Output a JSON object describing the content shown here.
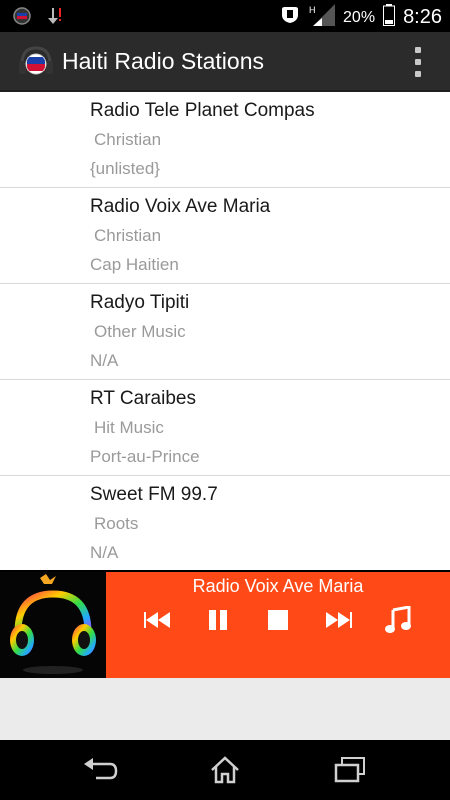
{
  "status_bar": {
    "left_icons": [
      "app-notification-icon",
      "download-icon"
    ],
    "right_icons": [
      "vibrate-icon",
      "signal-h-icon"
    ],
    "battery": "20%",
    "time": "8:26"
  },
  "action_bar": {
    "title": "Haiti Radio Stations",
    "app_icon": "radio-flag-icon",
    "menu_icon": "overflow-menu-icon"
  },
  "stations": [
    {
      "name": "Radio Tele Planet Compas",
      "genre": "Christian",
      "location": "{unlisted}"
    },
    {
      "name": "Radio Voix Ave Maria",
      "genre": "Christian",
      "location": "Cap Haitien"
    },
    {
      "name": "Radyo Tipiti",
      "genre": "Other Music",
      "location": "N/A"
    },
    {
      "name": "RT Caraibes",
      "genre": "Hit Music",
      "location": "Port-au-Prince"
    },
    {
      "name": "Sweet FM 99.7",
      "genre": "Roots",
      "location": "N/A"
    }
  ],
  "player": {
    "now_playing": "Radio Voix Ave Maria",
    "controls": [
      "previous-icon",
      "pause-icon",
      "stop-icon",
      "next-icon",
      "music-note-icon"
    ],
    "accent_color": "#ff4a17"
  },
  "nav_bar": {
    "buttons": [
      "back-icon",
      "home-icon",
      "recent-apps-icon"
    ]
  }
}
